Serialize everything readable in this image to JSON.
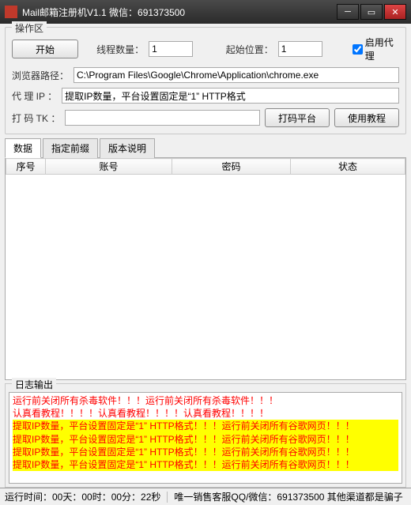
{
  "titlebar": {
    "title": "Mail邮箱注册机V1.1  微信：691373500"
  },
  "controls": {
    "group_label": "操作区",
    "start_btn": "开始",
    "threads_label": "线程数量：",
    "threads_value": "1",
    "startpos_label": "起始位置：",
    "startpos_value": "1",
    "proxy_enable_label": "启用代理",
    "browser_label": "浏览器路径：",
    "browser_value": "C:\\Program Files\\Google\\Chrome\\Application\\chrome.exe",
    "proxyip_label": "代 理 IP ：",
    "proxyip_value": "提取IP数量，平台设置固定是“1” HTTP格式",
    "captcha_label": "打 码 TK ：",
    "captcha_value": "",
    "captcha_btn": "打码平台",
    "tutorial_btn": "使用教程"
  },
  "tabs": [
    "数据",
    "指定前缀",
    "版本说明"
  ],
  "table": {
    "headers": [
      "序号",
      "账号",
      "密码",
      "状态"
    ]
  },
  "log": {
    "label": "日志输出",
    "lines": [
      {
        "cls": "red",
        "text": "运行前关闭所有杀毒软件！！！运行前关闭所有杀毒软件！！！"
      },
      {
        "cls": "red",
        "text": "认真看教程！！！！认真看教程！！！！认真看教程！！！！"
      },
      {
        "cls": "redb",
        "text": "提取IP数量，平台设置固定是“1” HTTP格式！！！运行前关闭所有谷歌网页！！！"
      },
      {
        "cls": "redb",
        "text": "提取IP数量，平台设置固定是“1” HTTP格式！！！运行前关闭所有谷歌网页！！！"
      },
      {
        "cls": "redb",
        "text": "提取IP数量，平台设置固定是“1” HTTP格式！！！运行前关闭所有谷歌网页！！！"
      },
      {
        "cls": "redb",
        "text": "提取IP数量，平台设置固定是“1” HTTP格式！！！运行前关闭所有谷歌网页！！！"
      }
    ]
  },
  "status": {
    "runtime": "运行时间：00天：00时：00分：22秒",
    "contact": "唯一销售客服QQ/微信：691373500 其他渠道都是骗子"
  }
}
